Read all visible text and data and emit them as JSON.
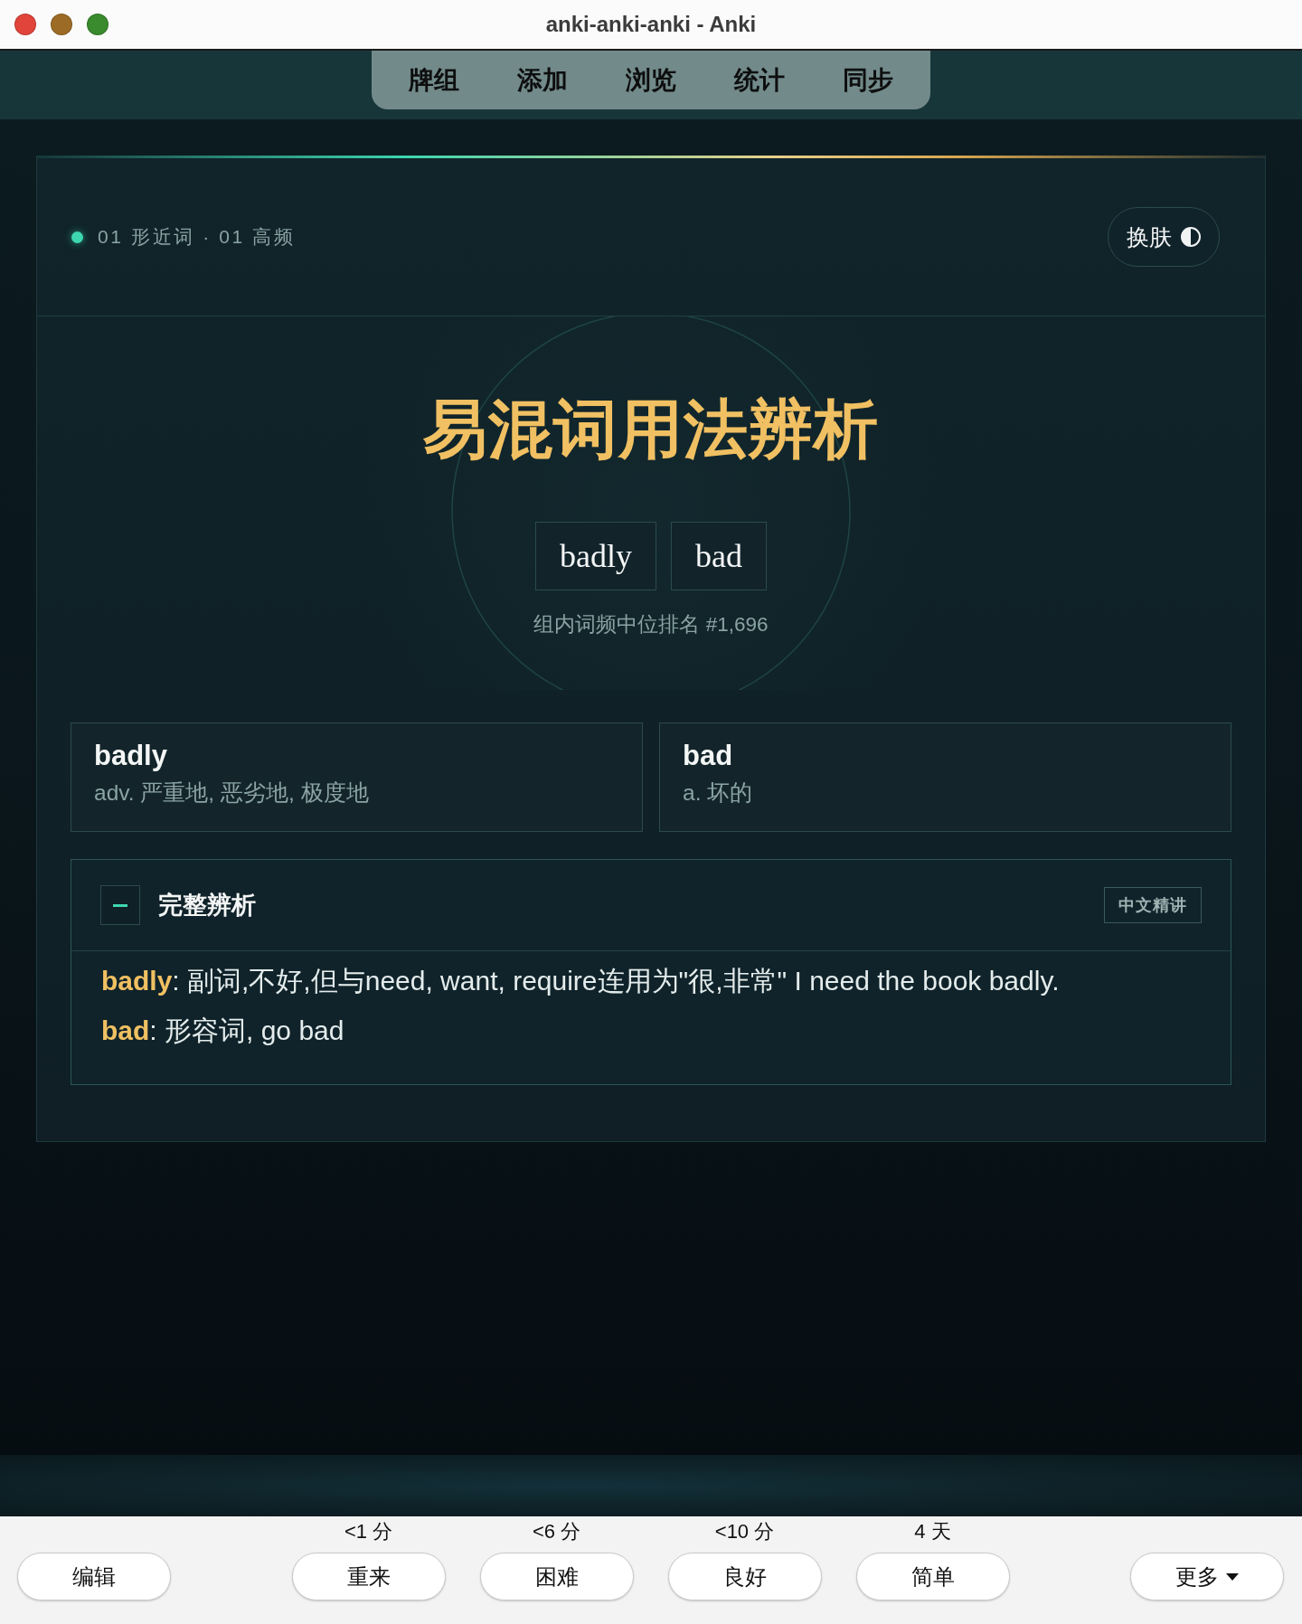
{
  "window": {
    "title": "anki-anki-anki - Anki"
  },
  "toolbar": {
    "tabs": [
      {
        "label": "牌组",
        "selected": false
      },
      {
        "label": "添加",
        "selected": false
      },
      {
        "label": "浏览",
        "selected": false
      },
      {
        "label": "统计",
        "selected": false
      },
      {
        "label": "同步",
        "selected": false
      }
    ]
  },
  "card": {
    "breadcrumb": "01 形近词 · 01 高频",
    "skin_button": {
      "label": "换肤"
    },
    "title": "易混词用法辨析",
    "words": [
      "badly",
      "bad"
    ],
    "rank": "组内词频中位排名 #1,696",
    "definitions": [
      {
        "word": "badly",
        "meaning": "adv. 严重地, 恶劣地, 极度地"
      },
      {
        "word": "bad",
        "meaning": "a. 坏的"
      }
    ],
    "analysis": {
      "title": "完整辨析",
      "expanded": true,
      "tag": "中文精讲",
      "lines": [
        "**badly**: 副词,不好,但与need, want, require连用为\"很,非常\" I need the book badly.",
        "**bad**: 形容词, go bad"
      ]
    }
  },
  "answer_bar": {
    "edit_button": "编辑",
    "ease_buttons": [
      {
        "interval": "<1 分",
        "label": "重来"
      },
      {
        "interval": "<6 分",
        "label": "困难"
      },
      {
        "interval": "<10 分",
        "label": "良好"
      },
      {
        "interval": "4 天",
        "label": "简单"
      }
    ],
    "more_button": "更多"
  }
}
